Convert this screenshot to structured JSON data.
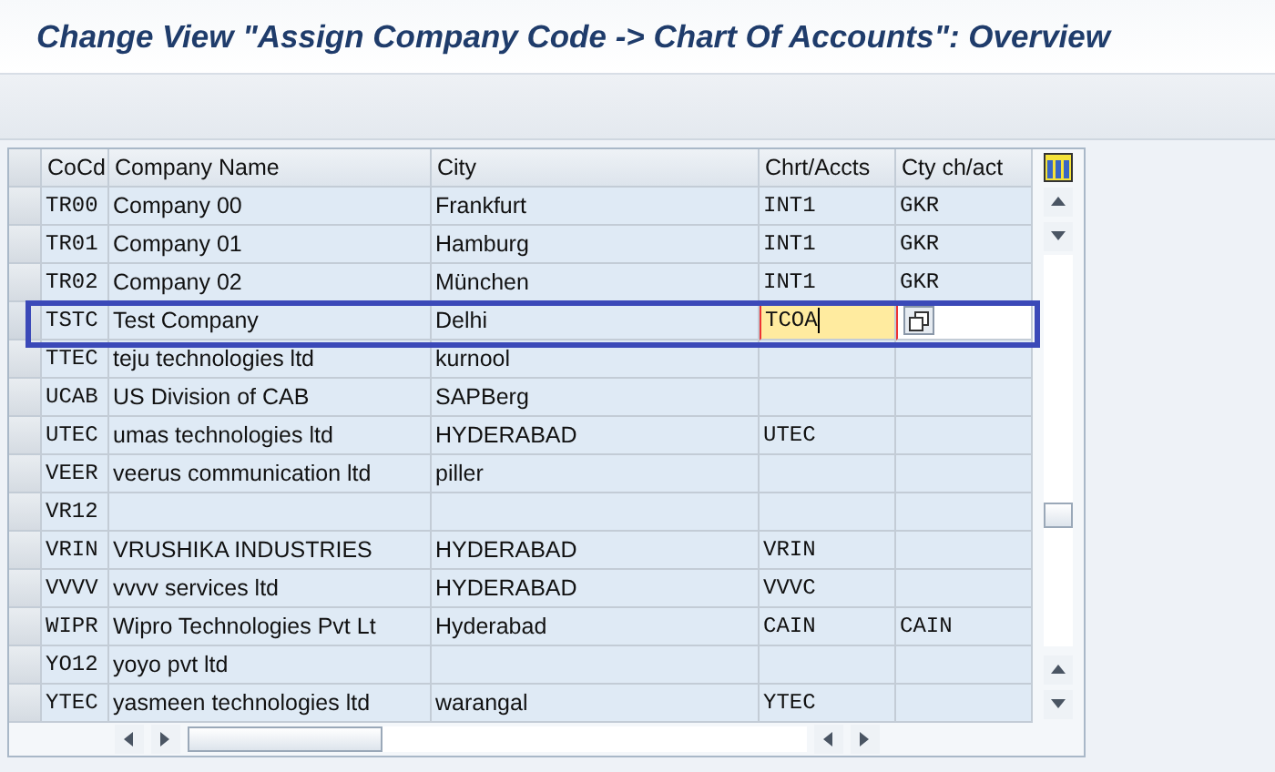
{
  "window": {
    "title": "Change View \"Assign Company Code -> Chart Of Accounts\": Overview"
  },
  "table": {
    "columns": [
      "CoCd",
      "Company Name",
      "City",
      "Chrt/Accts",
      "Cty ch/act"
    ],
    "rows": [
      {
        "cocd": "TR00",
        "name": "Company 00",
        "city": "Frankfurt",
        "chart": "INT1",
        "cty_chart": "GKR",
        "selected": false
      },
      {
        "cocd": "TR01",
        "name": "Company 01",
        "city": "Hamburg",
        "chart": "INT1",
        "cty_chart": "GKR",
        "selected": false
      },
      {
        "cocd": "TR02",
        "name": "Company 02",
        "city": "München",
        "chart": "INT1",
        "cty_chart": "GKR",
        "selected": false
      },
      {
        "cocd": "TSTC",
        "name": "Test Company",
        "city": "Delhi",
        "chart": "TCOA",
        "cty_chart": "",
        "selected": true
      },
      {
        "cocd": "TTEC",
        "name": "teju technologies ltd",
        "city": "kurnool",
        "chart": "",
        "cty_chart": "",
        "selected": false
      },
      {
        "cocd": "UCAB",
        "name": "US Division of CAB",
        "city": "SAPBerg",
        "chart": "",
        "cty_chart": "",
        "selected": false
      },
      {
        "cocd": "UTEC",
        "name": "umas technologies ltd",
        "city": "HYDERABAD",
        "chart": "UTEC",
        "cty_chart": "",
        "selected": false
      },
      {
        "cocd": "VEER",
        "name": "veerus communication ltd",
        "city": "piller",
        "chart": "",
        "cty_chart": "",
        "selected": false
      },
      {
        "cocd": "VR12",
        "name": "",
        "city": "",
        "chart": "",
        "cty_chart": "",
        "selected": false
      },
      {
        "cocd": "VRIN",
        "name": "VRUSHIKA INDUSTRIES",
        "city": "HYDERABAD",
        "chart": "VRIN",
        "cty_chart": "",
        "selected": false
      },
      {
        "cocd": "VVVV",
        "name": "vvvv services ltd",
        "city": "HYDERABAD",
        "chart": "VVVC",
        "cty_chart": "",
        "selected": false
      },
      {
        "cocd": "WIPR",
        "name": "Wipro Technologies Pvt Lt",
        "city": "Hyderabad",
        "chart": "CAIN",
        "cty_chart": "CAIN",
        "selected": false
      },
      {
        "cocd": "YO12",
        "name": "yoyo pvt ltd",
        "city": "",
        "chart": "",
        "cty_chart": "",
        "selected": false
      },
      {
        "cocd": "YTEC",
        "name": "yasmeen technologies ltd",
        "city": "warangal",
        "chart": "YTEC",
        "cty_chart": "",
        "selected": false
      }
    ]
  }
}
